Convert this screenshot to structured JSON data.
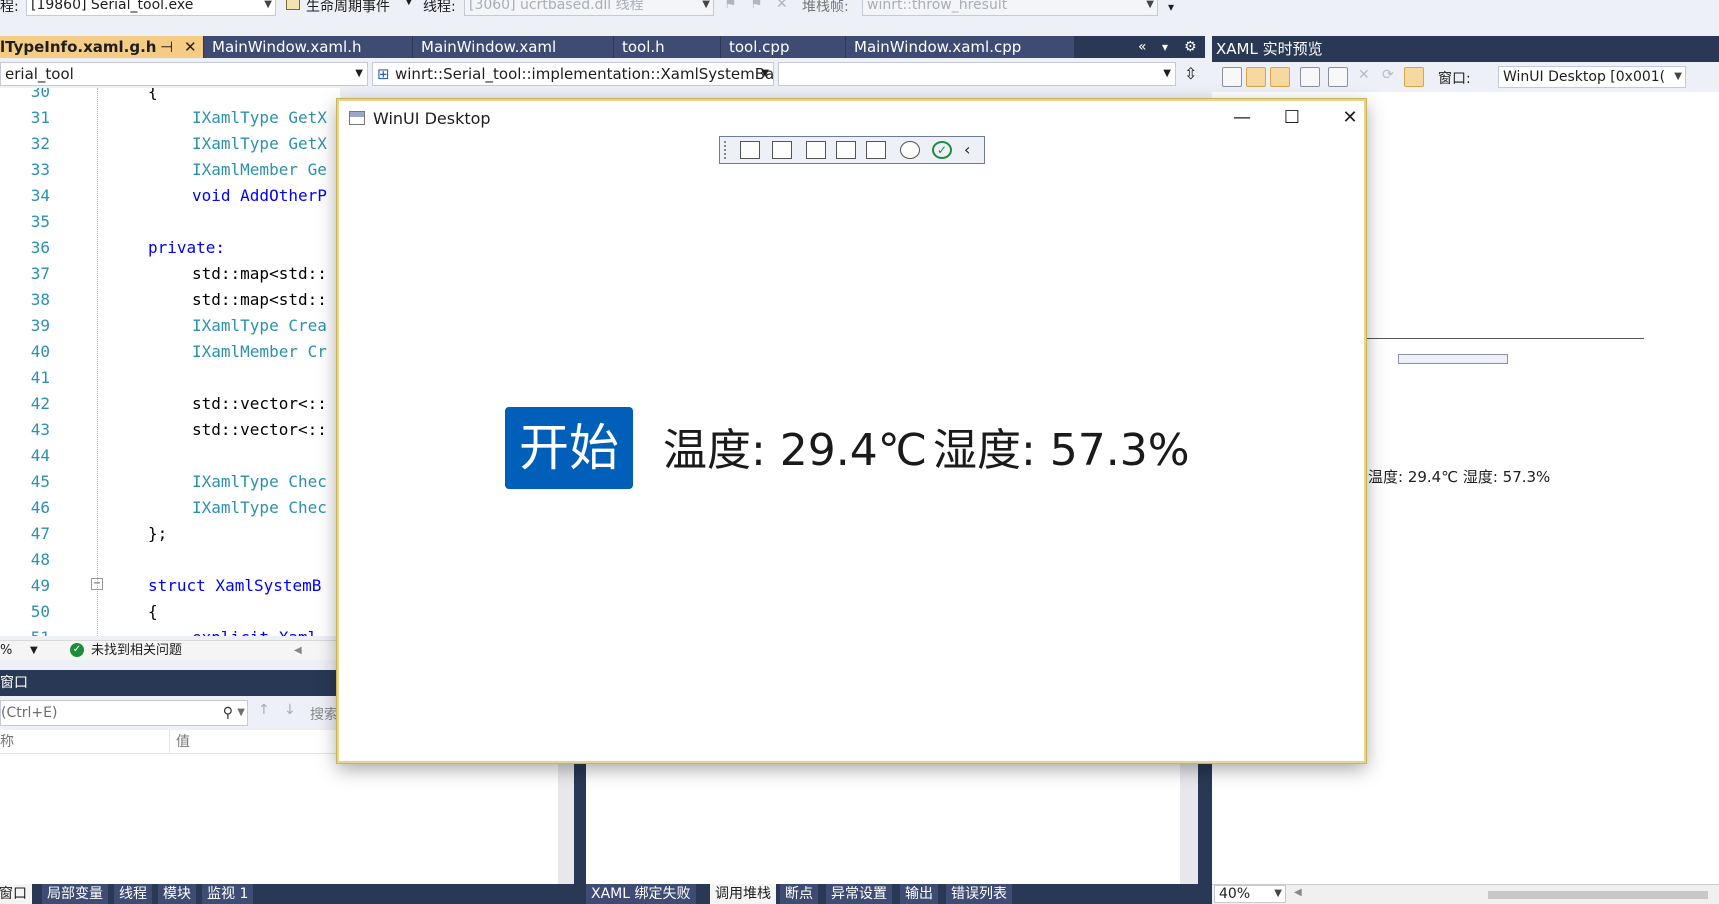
{
  "top_toolbar": {
    "process_label": "程:",
    "process_value": "[19860] Serial_tool.exe",
    "lifecycle_label": "生命周期事件",
    "thread_label": "线程:",
    "thread_value": "[3060] ucrtbased.dll 线程",
    "stackframe_label": "堆栈帧:",
    "stackframe_value": "winrt::throw_hresult"
  },
  "doc_tabs": [
    {
      "label": "lTypeInfo.xaml.g.h"
    },
    {
      "label": "MainWindow.xaml.h"
    },
    {
      "label": "MainWindow.xaml"
    },
    {
      "label": "tool.h"
    },
    {
      "label": "tool.cpp"
    },
    {
      "label": "MainWindow.xaml.cpp"
    }
  ],
  "nav": {
    "project": "erial_tool",
    "scope": "winrt::Serial_tool::implementation::XamlSystemBa",
    "member": ""
  },
  "editor": {
    "lines": [
      {
        "n": "30",
        "text": "{"
      },
      {
        "n": "31",
        "text": "IXamlType GetX"
      },
      {
        "n": "32",
        "text": "IXamlType GetX"
      },
      {
        "n": "33",
        "text": "IXamlMember Ge"
      },
      {
        "n": "34",
        "text": "void AddOtherP"
      },
      {
        "n": "35",
        "text": ""
      },
      {
        "n": "36",
        "text": "private:"
      },
      {
        "n": "37",
        "text": "std::map<std::"
      },
      {
        "n": "38",
        "text": "std::map<std::"
      },
      {
        "n": "39",
        "text": "IXamlType Crea"
      },
      {
        "n": "40",
        "text": "IXamlMember Cr"
      },
      {
        "n": "41",
        "text": ""
      },
      {
        "n": "42",
        "text": "std::vector<::"
      },
      {
        "n": "43",
        "text": "std::vector<::"
      },
      {
        "n": "44",
        "text": ""
      },
      {
        "n": "45",
        "text": "IXamlType Chec"
      },
      {
        "n": "46",
        "text": "IXamlType Chec"
      },
      {
        "n": "47",
        "text": "};"
      },
      {
        "n": "48",
        "text": ""
      },
      {
        "n": "49",
        "text": "struct XamlSystemB"
      },
      {
        "n": "50",
        "text": "{"
      },
      {
        "n": "51",
        "text": "explicit Xaml"
      }
    ]
  },
  "editor_status": {
    "zoom": "%",
    "issues": "未找到相关问题"
  },
  "watch_panel": {
    "title": "窗口",
    "search_placeholder": "(Ctrl+E)",
    "search_label": "搜索",
    "col_name": "称",
    "col_value": "值"
  },
  "bottom_tabs_left": [
    "窗口",
    "局部变量",
    "线程",
    "模块",
    "监视 1"
  ],
  "bottom_tabs_right": [
    "XAML 绑定失败",
    "调用堆栈",
    "断点",
    "异常设置",
    "输出",
    "错误列表"
  ],
  "xaml_preview": {
    "title": "XAML 实时预览",
    "window_label": "窗口:",
    "window_value": "WinUI Desktop [0x001(",
    "mini_reading": "温度: 29.4℃   湿度: 57.3%",
    "zoom": "40%"
  },
  "app_window": {
    "title": "WinUI Desktop",
    "minimize": "—",
    "maximize": "☐",
    "close": "✕",
    "start_button": "开始",
    "temperature": "温度: 29.4℃",
    "humidity": "湿度: 57.3%"
  },
  "colors": {
    "accent_blue": "#005fb8",
    "vs_dark": "#293955",
    "active_tab": "#f5cc84"
  }
}
